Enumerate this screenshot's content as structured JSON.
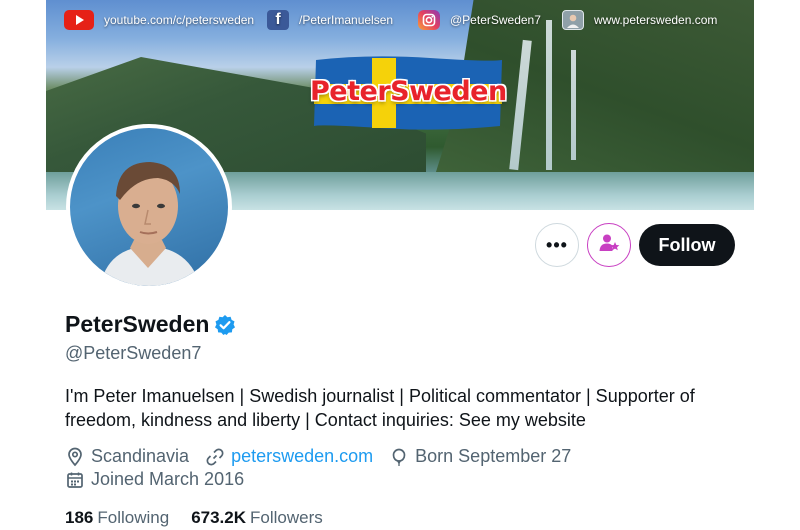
{
  "banner": {
    "social": {
      "youtube": "youtube.com/c/petersweden",
      "facebook": "/PeterImanuelsen",
      "instagram": "@PeterSweden7",
      "website": "www.petersweden.com"
    },
    "logo_text": "PeterSweden"
  },
  "actions": {
    "more": "•••",
    "follow": "Follow"
  },
  "profile": {
    "display_name": "PeterSweden",
    "handle": "@PeterSweden7",
    "bio": "I'm Peter Imanuelsen | Swedish journalist | Political commentator | Supporter of freedom, kindness and liberty | Contact inquiries: See my website",
    "location": "Scandinavia",
    "website": "petersweden.com",
    "birthday": "Born September 27",
    "joined": "Joined March 2016"
  },
  "stats": {
    "following_count": "186",
    "following_label": "Following",
    "followers_count": "673.2K",
    "followers_label": "Followers"
  },
  "colors": {
    "accent_link": "#1d9bf0",
    "verified": "#1d9bf0",
    "follow_button": "#0f1419",
    "subscribe_accent": "#c83fc2"
  }
}
